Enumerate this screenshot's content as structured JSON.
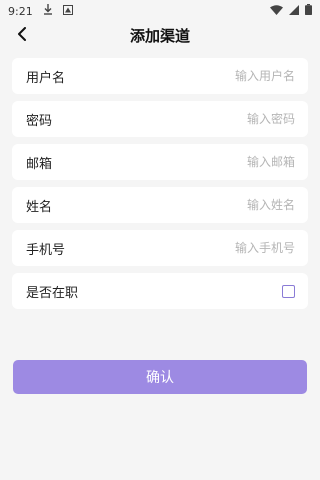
{
  "status_bar": {
    "time": "9:21"
  },
  "nav": {
    "title": "添加渠道"
  },
  "form": {
    "fields": [
      {
        "label": "用户名",
        "placeholder": "输入用户名"
      },
      {
        "label": "密码",
        "placeholder": "输入密码"
      },
      {
        "label": "邮箱",
        "placeholder": "输入邮箱"
      },
      {
        "label": "姓名",
        "placeholder": "输入姓名"
      },
      {
        "label": "手机号",
        "placeholder": "输入手机号"
      }
    ],
    "employed": {
      "label": "是否在职",
      "checked": false
    }
  },
  "actions": {
    "confirm_label": "确认"
  },
  "colors": {
    "accent": "#9d8ae3",
    "checkbox_border": "#8a7bd6",
    "background": "#f5f5f5"
  }
}
